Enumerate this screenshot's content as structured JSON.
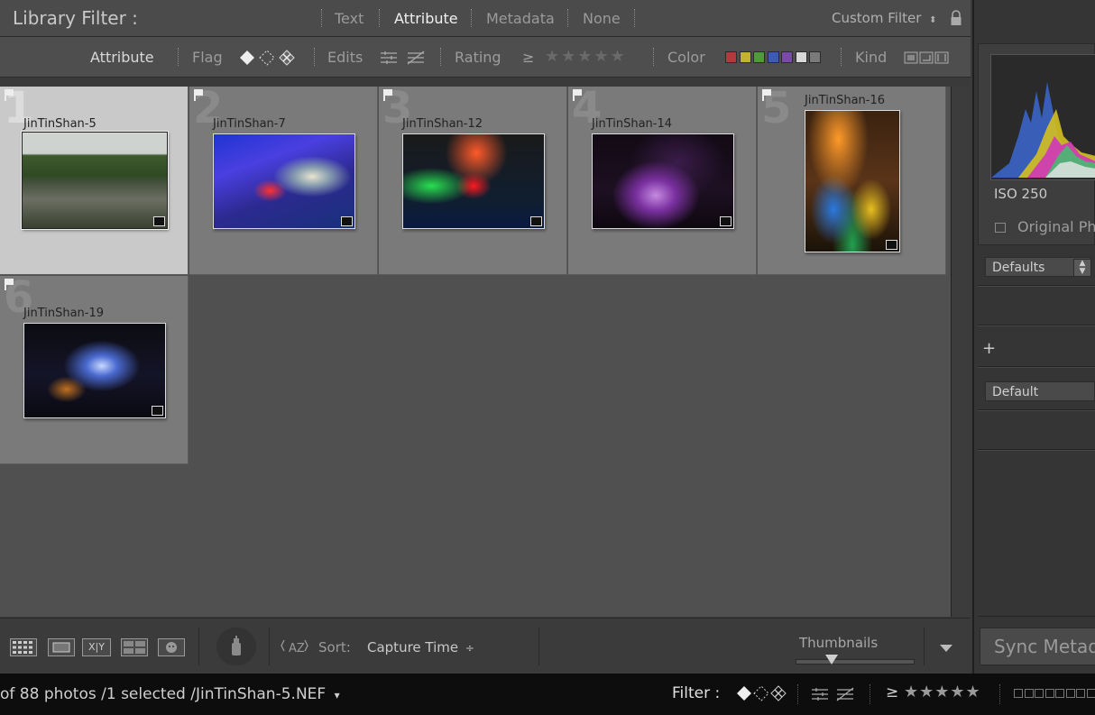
{
  "filter_bar": {
    "title": "Library Filter :",
    "tabs": [
      "Text",
      "Attribute",
      "Metadata",
      "None"
    ],
    "active_tab": "Attribute",
    "preset": "Custom Filter"
  },
  "attribute_bar": {
    "attribute_label": "Attribute",
    "flag_label": "Flag",
    "edits_label": "Edits",
    "rating_label": "Rating",
    "rating_op": "≥",
    "rating_stars": "★★★★★",
    "color_label": "Color",
    "kind_label": "Kind",
    "colors": [
      "#b33a3a",
      "#c2b22f",
      "#4f9a3a",
      "#3d5bb0",
      "#7a4aa8",
      "#d8d8d8",
      "#7a7a7a"
    ]
  },
  "grid": {
    "cells": [
      {
        "index": "1",
        "name": "JinTinShan-5",
        "selected": true
      },
      {
        "index": "2",
        "name": "JinTinShan-7",
        "selected": false
      },
      {
        "index": "3",
        "name": "JinTinShan-12",
        "selected": false
      },
      {
        "index": "4",
        "name": "JinTinShan-14",
        "selected": false
      },
      {
        "index": "5",
        "name": "JinTinShan-16",
        "selected": false
      },
      {
        "index": "6",
        "name": "JinTinShan-19",
        "selected": false
      }
    ]
  },
  "toolbar": {
    "sort_label": "Sort:",
    "sort_value": "Capture Time",
    "sort_caret": "÷",
    "thumbnails_label": "Thumbnails",
    "thumbnail_size_fraction": 0.3,
    "view_xy_label": "X|Y"
  },
  "right_panel": {
    "iso": "ISO 250",
    "original_photo": "Original Photo",
    "defaults_preset": "Defaults",
    "plus": "+",
    "default_preset": "Default",
    "sync_button": "Sync Metadata"
  },
  "status_bar": {
    "text": "of 88 photos /1 selected /JinTinShan-5.NEF",
    "caret": "▾",
    "filter_label": "Filter :",
    "filter_op": "≥",
    "filter_stars": "★★★★★"
  }
}
